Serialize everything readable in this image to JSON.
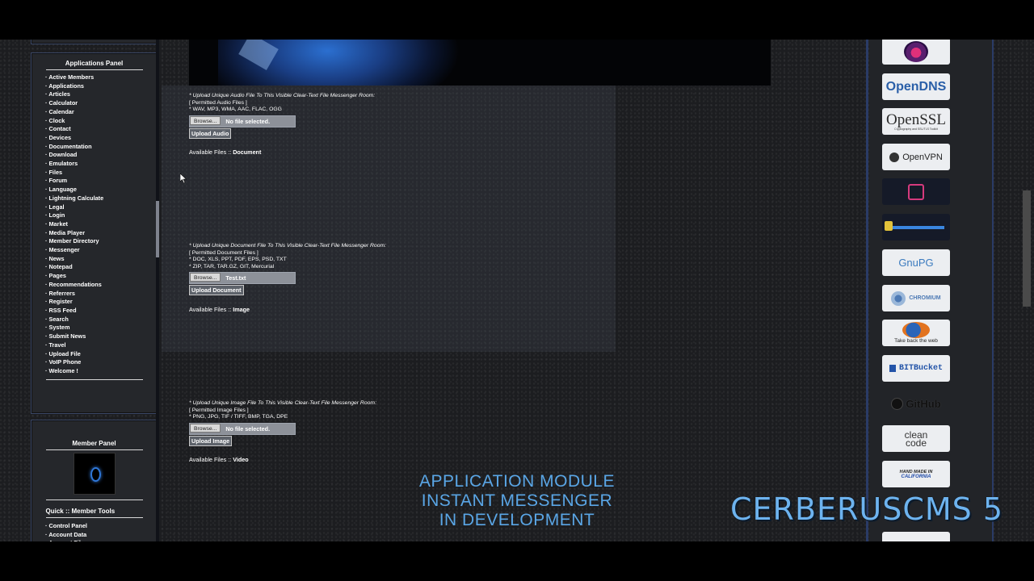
{
  "applications_panel": {
    "title": "Applications Panel",
    "items": [
      "Active Members",
      "Applications",
      "Articles",
      "Calculator",
      "Calendar",
      "Clock",
      "Contact",
      "Devices",
      "Documentation",
      "Download",
      "Emulators",
      "Files",
      "Forum",
      "Language",
      "Lightning Calculate",
      "Legal",
      "Login",
      "Market",
      "Media Player",
      "Member Directory",
      "Messenger",
      "News",
      "Notepad",
      "Pages",
      "Recommendations",
      "Referrers",
      "Register",
      "RSS Feed",
      "Search",
      "System",
      "Submit News",
      "Travel",
      "Upload File",
      "VoIP Phone",
      "Welcome !"
    ]
  },
  "member_panel": {
    "title": "Member Panel",
    "tools_title": "Quick :: Member Tools",
    "tools": [
      "Control Panel",
      "Account Data",
      "Account Files"
    ]
  },
  "audio": {
    "heading": "* Upload Unique Audio File To This Visible Clear-Text File Messenger Room:",
    "permitted": "[ Permitted Audio Files ]",
    "types": "* WAV, MP3, WMA, AAC, FLAC, OGG",
    "browse": "Browse...",
    "file": "No file selected.",
    "upload": "Upload Audio"
  },
  "document": {
    "avail_prefix": "Available Files :: ",
    "avail_name": "Document",
    "heading": "* Upload Unique Document File To This Visible Clear-Text File Messenger Room:",
    "permitted": "[ Permitted Document Files ]",
    "types1": "* DOC, XLS, PPT, PDF, EPS, PSD, TXT",
    "types2": "* ZIP, TAR, TAR.GZ, GIT, Mercurial",
    "browse": "Browse...",
    "file": "Test.txt",
    "upload": "Upload Document"
  },
  "image": {
    "avail_prefix": "Available Files :: ",
    "avail_name": "Image",
    "heading": "* Upload Unique Image File To This Visible Clear-Text File Messenger Room:",
    "permitted": "[ Permitted Image Files ]",
    "types": "* PNG, JPG, TIF / TIFF, BMP, TGA, DPE",
    "browse": "Browse...",
    "file": "No file selected.",
    "upload": "Upload Image"
  },
  "video": {
    "avail_prefix": "Available Files :: ",
    "avail_name": "Video"
  },
  "caption": {
    "line1": "APPLICATION MODULE",
    "line2": "INSTANT MESSENGER",
    "line3": "IN DEVELOPMENT"
  },
  "brand": "CERBERUSCMS 5",
  "badges": {
    "opendns": "OpenDNS",
    "openssl": "OpenSSL",
    "openssl_sub": "Cryptography and SSL/TLS Toolkit",
    "openvpn": "OpenVPN",
    "gnupg": "GnuPG",
    "chromium": "CHROMIUM",
    "firefox": "Take back the web",
    "bitbucket": "BITBucket",
    "github": "GitHub",
    "cleancode1": "clean",
    "cleancode2": "code",
    "handmade1": "HAND MADE IN",
    "handmade2": "CALIFORNIA"
  },
  "colors": {
    "accent_blue": "#5aa6e6",
    "panel_border": "#3a4766"
  }
}
